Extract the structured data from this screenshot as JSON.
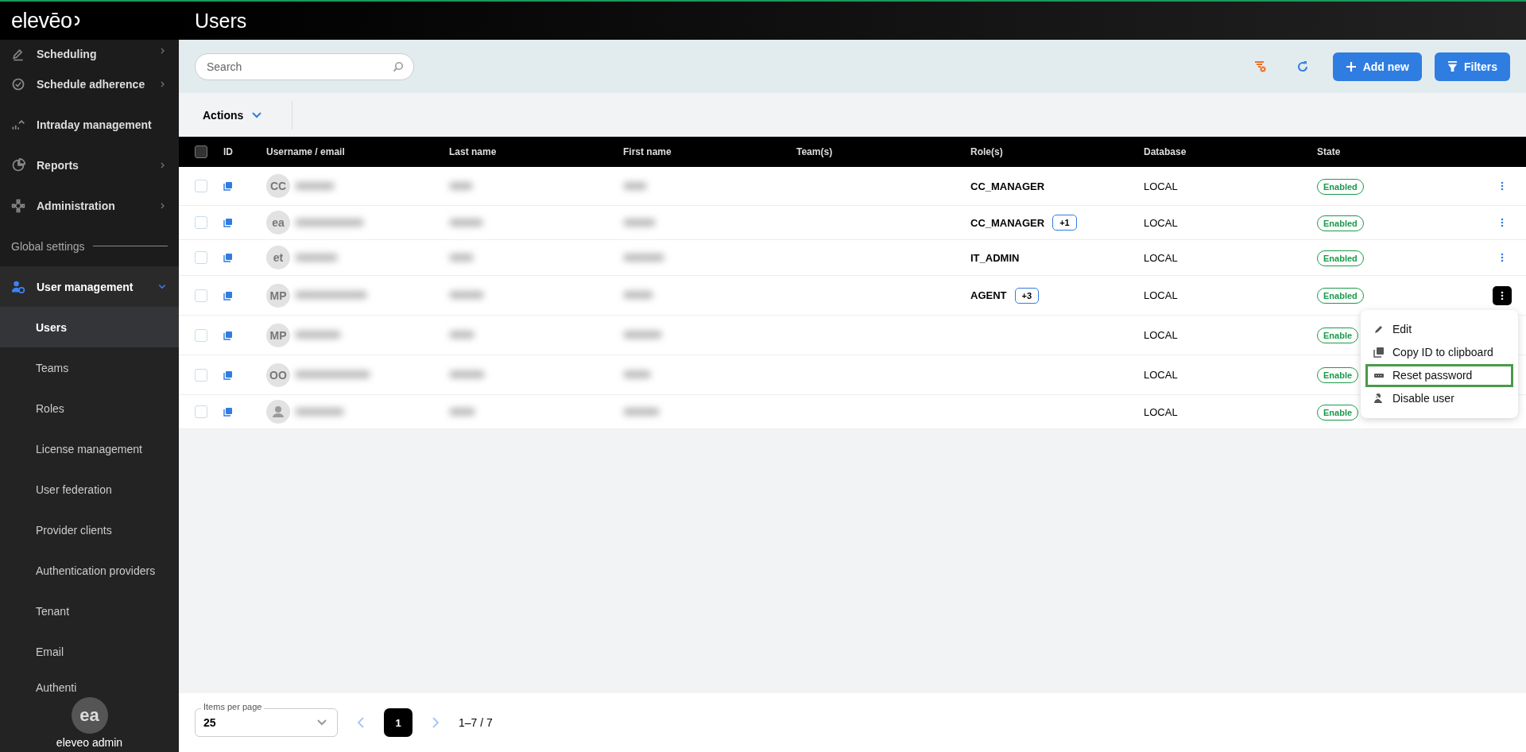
{
  "logo": "elevēo",
  "page_title": "Users",
  "sidebar": {
    "items": [
      {
        "label": "Scheduling",
        "expanded": false
      },
      {
        "label": "Schedule adherence",
        "expanded": false
      },
      {
        "label": "Intraday management"
      },
      {
        "label": "Reports",
        "expanded": false
      },
      {
        "label": "Administration",
        "expanded": false
      }
    ],
    "section": "Global settings",
    "group": {
      "label": "User management",
      "expanded": true,
      "children": [
        {
          "label": "Users",
          "selected": true
        },
        {
          "label": "Teams",
          "selected": false
        },
        {
          "label": "Roles",
          "selected": false
        },
        {
          "label": "License management",
          "selected": false
        },
        {
          "label": "User federation",
          "selected": false
        },
        {
          "label": "Provider clients",
          "selected": false
        },
        {
          "label": "Authentication providers",
          "selected": false
        },
        {
          "label": "Tenant",
          "selected": false
        },
        {
          "label": "Email",
          "selected": false
        },
        {
          "label": "Authenti",
          "selected": false
        }
      ]
    },
    "user": {
      "initials": "ea",
      "name": "eleveo admin"
    }
  },
  "search": {
    "placeholder": "Search"
  },
  "toolbar": {
    "add_label": "Add new",
    "filters_label": "Filters"
  },
  "actions_label": "Actions",
  "table": {
    "all_checked": false,
    "columns": [
      "ID",
      "Username / email",
      "Last name",
      "First name",
      "Team(s)",
      "Role(s)",
      "Database",
      "State"
    ],
    "rows": [
      {
        "checked": false,
        "avatar": "CC",
        "role": "CC_MANAGER",
        "database": "LOCAL",
        "state": "Enabled",
        "menu_open": false
      },
      {
        "checked": false,
        "avatar": "ea",
        "role": "CC_MANAGER",
        "extra": "+1",
        "database": "LOCAL",
        "state": "Enabled",
        "menu_open": false
      },
      {
        "checked": false,
        "avatar": "et",
        "role": "IT_ADMIN",
        "database": "LOCAL",
        "state": "Enabled",
        "menu_open": false
      },
      {
        "checked": false,
        "avatar": "MP",
        "role": "AGENT",
        "extra": "+3",
        "database": "LOCAL",
        "state": "Enabled",
        "menu_open": true
      },
      {
        "checked": false,
        "avatar": "MP",
        "database": "LOCAL",
        "state": "Enable"
      },
      {
        "checked": false,
        "avatar": "OO",
        "database": "LOCAL",
        "state": "Enable"
      },
      {
        "checked": false,
        "database": "LOCAL",
        "state": "Enable"
      }
    ]
  },
  "context_menu": [
    {
      "label": "Edit",
      "selected": false
    },
    {
      "label": "Copy ID to clipboard",
      "selected": false
    },
    {
      "label": "Reset password",
      "selected": true
    },
    {
      "label": "Disable user",
      "selected": false
    }
  ],
  "pagination": {
    "items_label": "Items per page",
    "items_value": "25",
    "page": "1",
    "range": "1–7 / 7"
  }
}
